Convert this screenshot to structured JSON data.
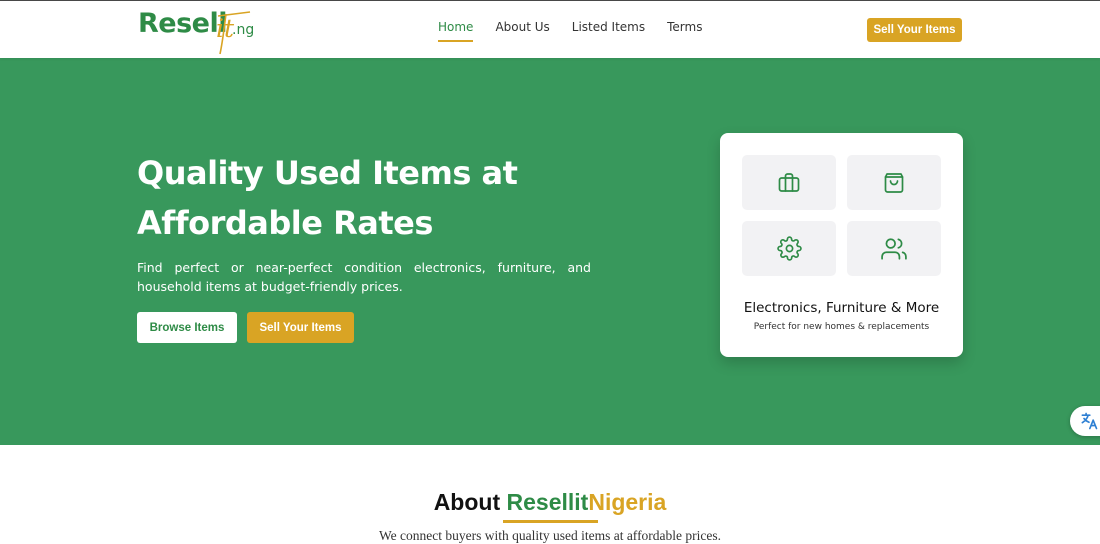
{
  "brand": {
    "logo_main": "Resell",
    "logo_it": "it",
    "logo_tld": ".ng"
  },
  "nav": {
    "links": [
      {
        "label": "Home",
        "active": true
      },
      {
        "label": "About Us",
        "active": false
      },
      {
        "label": "Listed Items",
        "active": false
      },
      {
        "label": "Terms",
        "active": false
      }
    ],
    "cta_label": "Sell Your Items"
  },
  "hero": {
    "title": "Quality Used Items at Affordable Rates",
    "subtitle": "Find perfect or near-perfect condition electronics, furniture, and household items at budget-friendly prices.",
    "browse_label": "Browse Items",
    "sell_label": "Sell Your Items"
  },
  "feature_card": {
    "icons": [
      "briefcase-icon",
      "shopping-bag-icon",
      "gear-icon",
      "users-icon"
    ],
    "title": "Electronics, Furniture & More",
    "subtitle": "Perfect for new homes & replacements"
  },
  "about": {
    "title_prefix": "About ",
    "title_green": "Resellit",
    "title_gold": "Nigeria",
    "text": "We connect buyers with quality used items at affordable prices."
  },
  "colors": {
    "primary_green": "#2e8b46",
    "hero_green": "#38985c",
    "accent_gold": "#d9a424"
  }
}
